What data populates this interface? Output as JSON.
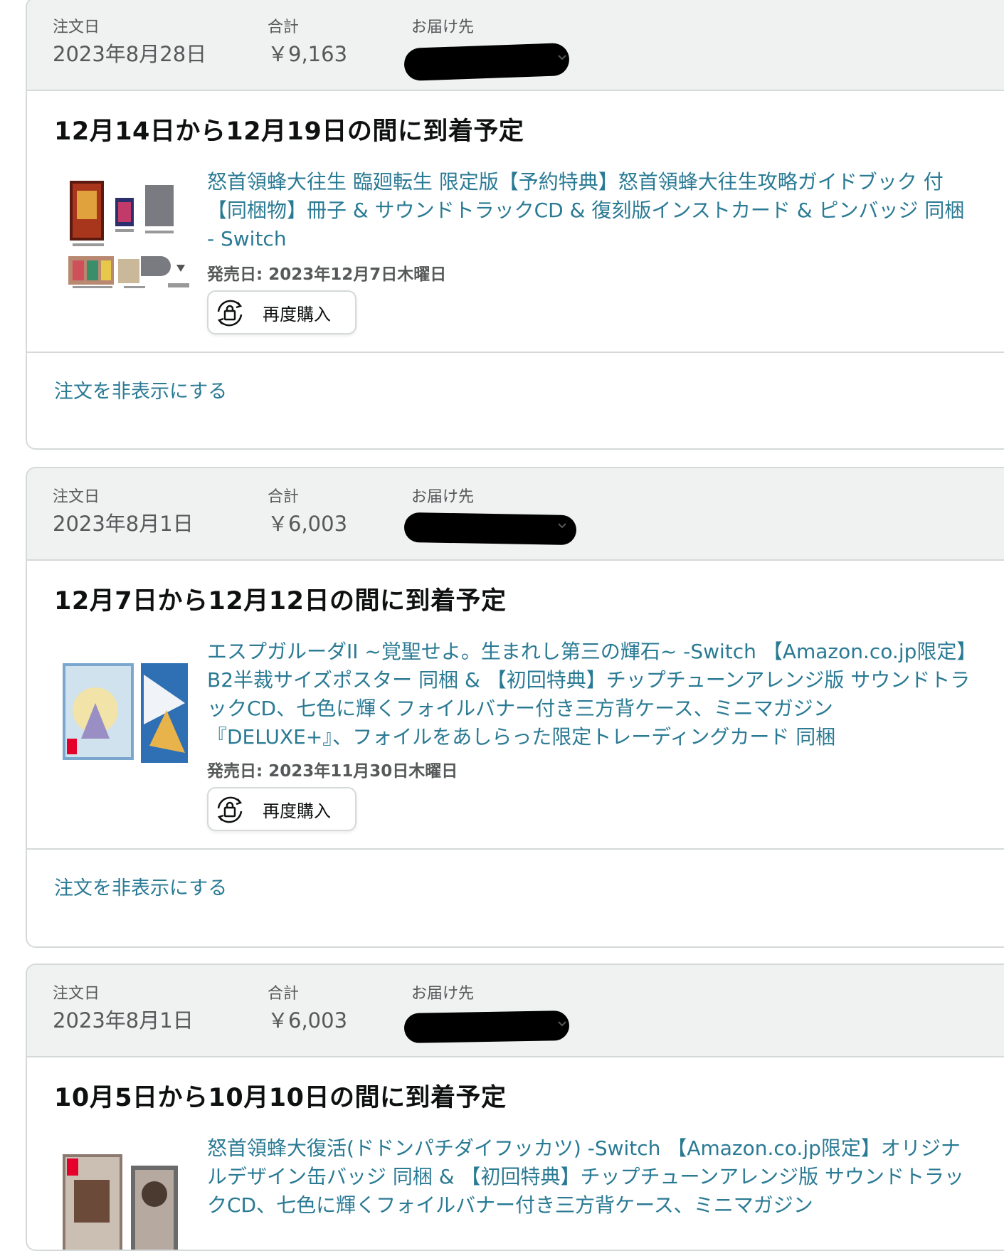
{
  "orders": [
    {
      "order_date_label": "注文日",
      "order_date": "2023年8月28日",
      "total_label": "合計",
      "total": "￥9,163",
      "ship_to_label": "お届け先",
      "arrival": "12月14日から12月19日の間に到着予定",
      "product_title": "怒首領蜂大往生 臨廻転生 限定版【予約特典】怒首領蜂大往生攻略ガイドブック 付【同梱物】冊子 & サウンドトラックCD & 復刻版インストカード & ピンバッジ 同梱 - Switch",
      "release": "発売日: 2023年12月7日木曜日",
      "buy_again": "再度購入",
      "hide_order": "注文を非表示にする"
    },
    {
      "order_date_label": "注文日",
      "order_date": "2023年8月1日",
      "total_label": "合計",
      "total": "￥6,003",
      "ship_to_label": "お届け先",
      "arrival": "12月7日から12月12日の間に到着予定",
      "product_title": "エスプガルーダII ~覚聖せよ。生まれし第三の輝石~ -Switch 【Amazon.co.jp限定】B2半裁サイズポスター 同梱 & 【初回特典】チップチューンアレンジ版 サウンドトラックCD、七色に輝くフォイルバナー付き三方背ケース、ミニマガジン『DELUXE+』、フォイルをあしらった限定トレーディングカード 同梱",
      "release": "発売日: 2023年11月30日木曜日",
      "buy_again": "再度購入",
      "hide_order": "注文を非表示にする"
    },
    {
      "order_date_label": "注文日",
      "order_date": "2023年8月1日",
      "total_label": "合計",
      "total": "￥6,003",
      "ship_to_label": "お届け先",
      "arrival": "10月5日から10月10日の間に到着予定",
      "product_title": "怒首領蜂大復活(ドドンパチダイフッカツ) -Switch 【Amazon.co.jp限定】オリジナルデザイン缶バッジ 同梱 & 【初回特典】チップチューンアレンジ版 サウンドトラックCD、七色に輝くフォイルバナー付き三方背ケース、ミニマガジン"
    }
  ],
  "colors": {
    "link": "#2a7a94",
    "header_bg": "#f0f2f2",
    "border": "#d5d9d9",
    "primary_button": "#ffd814"
  }
}
